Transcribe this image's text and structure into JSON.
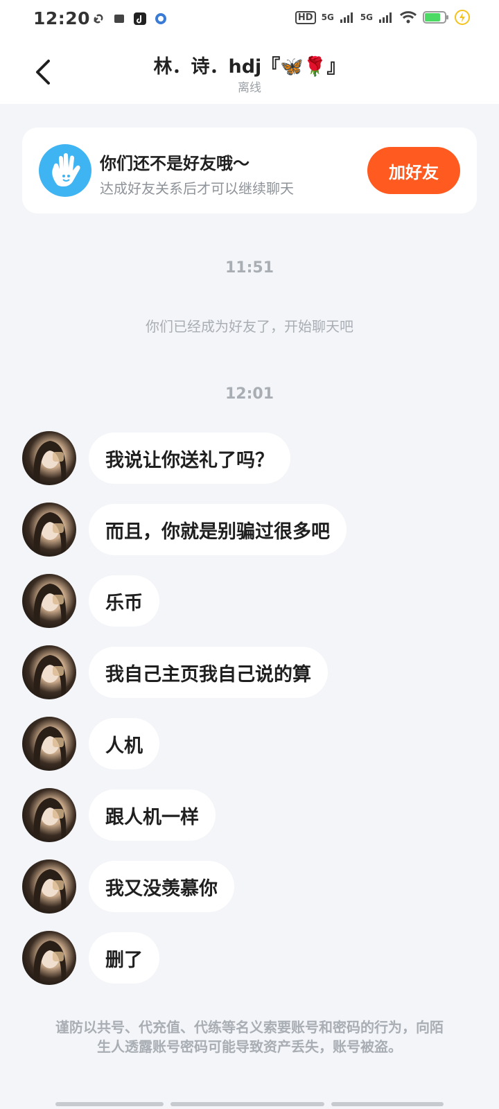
{
  "status_bar": {
    "time": "12:20",
    "net_hd": "HD",
    "net_5g_1": "5G",
    "net_5g_2": "5G"
  },
  "header": {
    "title": "林．诗．hdj『🦋🌹』",
    "subtitle": "离线"
  },
  "friend_card": {
    "title": "你们还不是好友哦～",
    "subtitle": "达成好友关系后才可以继续聊天",
    "add_button": "加好友"
  },
  "timeline": {
    "ts1": "11:51",
    "system_msg": "你们已经成为好友了，开始聊天吧",
    "ts2": "12:01"
  },
  "messages": [
    {
      "text": "我说让你送礼了吗？"
    },
    {
      "text": "而且，你就是别骗过很多吧"
    },
    {
      "text": "乐币"
    },
    {
      "text": "我自己主页我自己说的算"
    },
    {
      "text": "人机"
    },
    {
      "text": "跟人机一样"
    },
    {
      "text": "我又没羡慕你"
    },
    {
      "text": "删了"
    }
  ],
  "notice": "谨防以共号、代充值、代练等名义索要账号和密码的行为，向陌生人透露账号密码可能导致资产丢失，账号被盗。",
  "colors": {
    "background": "#f3f5f8",
    "accent": "#ff5a1f",
    "hand_icon": "#3fb4f2"
  }
}
